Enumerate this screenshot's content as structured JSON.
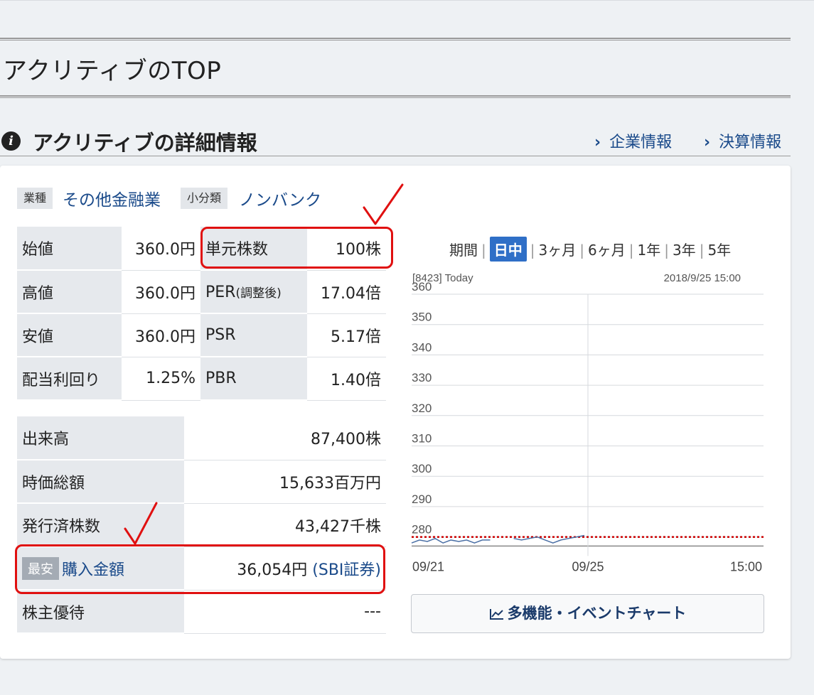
{
  "page": {
    "title": "アクリティブのTOP"
  },
  "section": {
    "title": "アクリティブの詳細情報",
    "links": {
      "company": "企業情報",
      "earnings": "決算情報"
    }
  },
  "category": {
    "industry_tag": "業種",
    "industry": "その他金融業",
    "sub_tag": "小分類",
    "sub": "ノンバンク"
  },
  "prices": [
    {
      "label": "始値",
      "value": "360.0円",
      "label2": "単元株数",
      "value2": "100株"
    },
    {
      "label": "高値",
      "value": "360.0円",
      "label2": "PER",
      "label2_suffix": "(調整後)",
      "value2": "17.04倍"
    },
    {
      "label": "安値",
      "value": "360.0円",
      "label2": "PSR",
      "value2": "5.17倍"
    },
    {
      "label": "配当利回り",
      "value": "1.25%",
      "label2": "PBR",
      "value2": "1.40倍"
    }
  ],
  "stats": [
    {
      "label": "出来高",
      "value": "87,400株"
    },
    {
      "label": "時価総額",
      "value": "15,633百万円"
    },
    {
      "label": "発行済株数",
      "value": "43,427千株"
    }
  ],
  "purchase": {
    "badge": "最安",
    "label": "購入金額",
    "value": "36,054円",
    "broker": "(SBI証券)"
  },
  "benefit": {
    "label": "株主優待",
    "value": "---"
  },
  "period": {
    "label": "期間",
    "options": [
      "日中",
      "3ヶ月",
      "6ヶ月",
      "1年",
      "3年",
      "5年"
    ],
    "active": "日中"
  },
  "chart_data": {
    "type": "line",
    "code": "[8423] Today",
    "datetime": "2018/9/25 15:00",
    "y_ticks": [
      360,
      350,
      340,
      330,
      320,
      310,
      300,
      290,
      280
    ],
    "ylim": [
      277,
      360
    ],
    "x_ticks": [
      "09/21",
      "09/25",
      "15:00"
    ],
    "reference_line": 280,
    "reference_color": "#cc0000",
    "series": [
      {
        "values": [
          278,
          279,
          278.5,
          279.5,
          278,
          279,
          278.5,
          279,
          278,
          279,
          279,
          null,
          null,
          279.5,
          279,
          279.5,
          280,
          279,
          278,
          279,
          279.5,
          280,
          280.5
        ]
      }
    ],
    "line_color": "#4a6fa5",
    "grid": true
  },
  "chart_button": {
    "label": "多機能・イベントチャート"
  },
  "colors": {
    "link": "#1a4a8a",
    "active": "#2f6fc7",
    "annotation": "#e01010"
  }
}
